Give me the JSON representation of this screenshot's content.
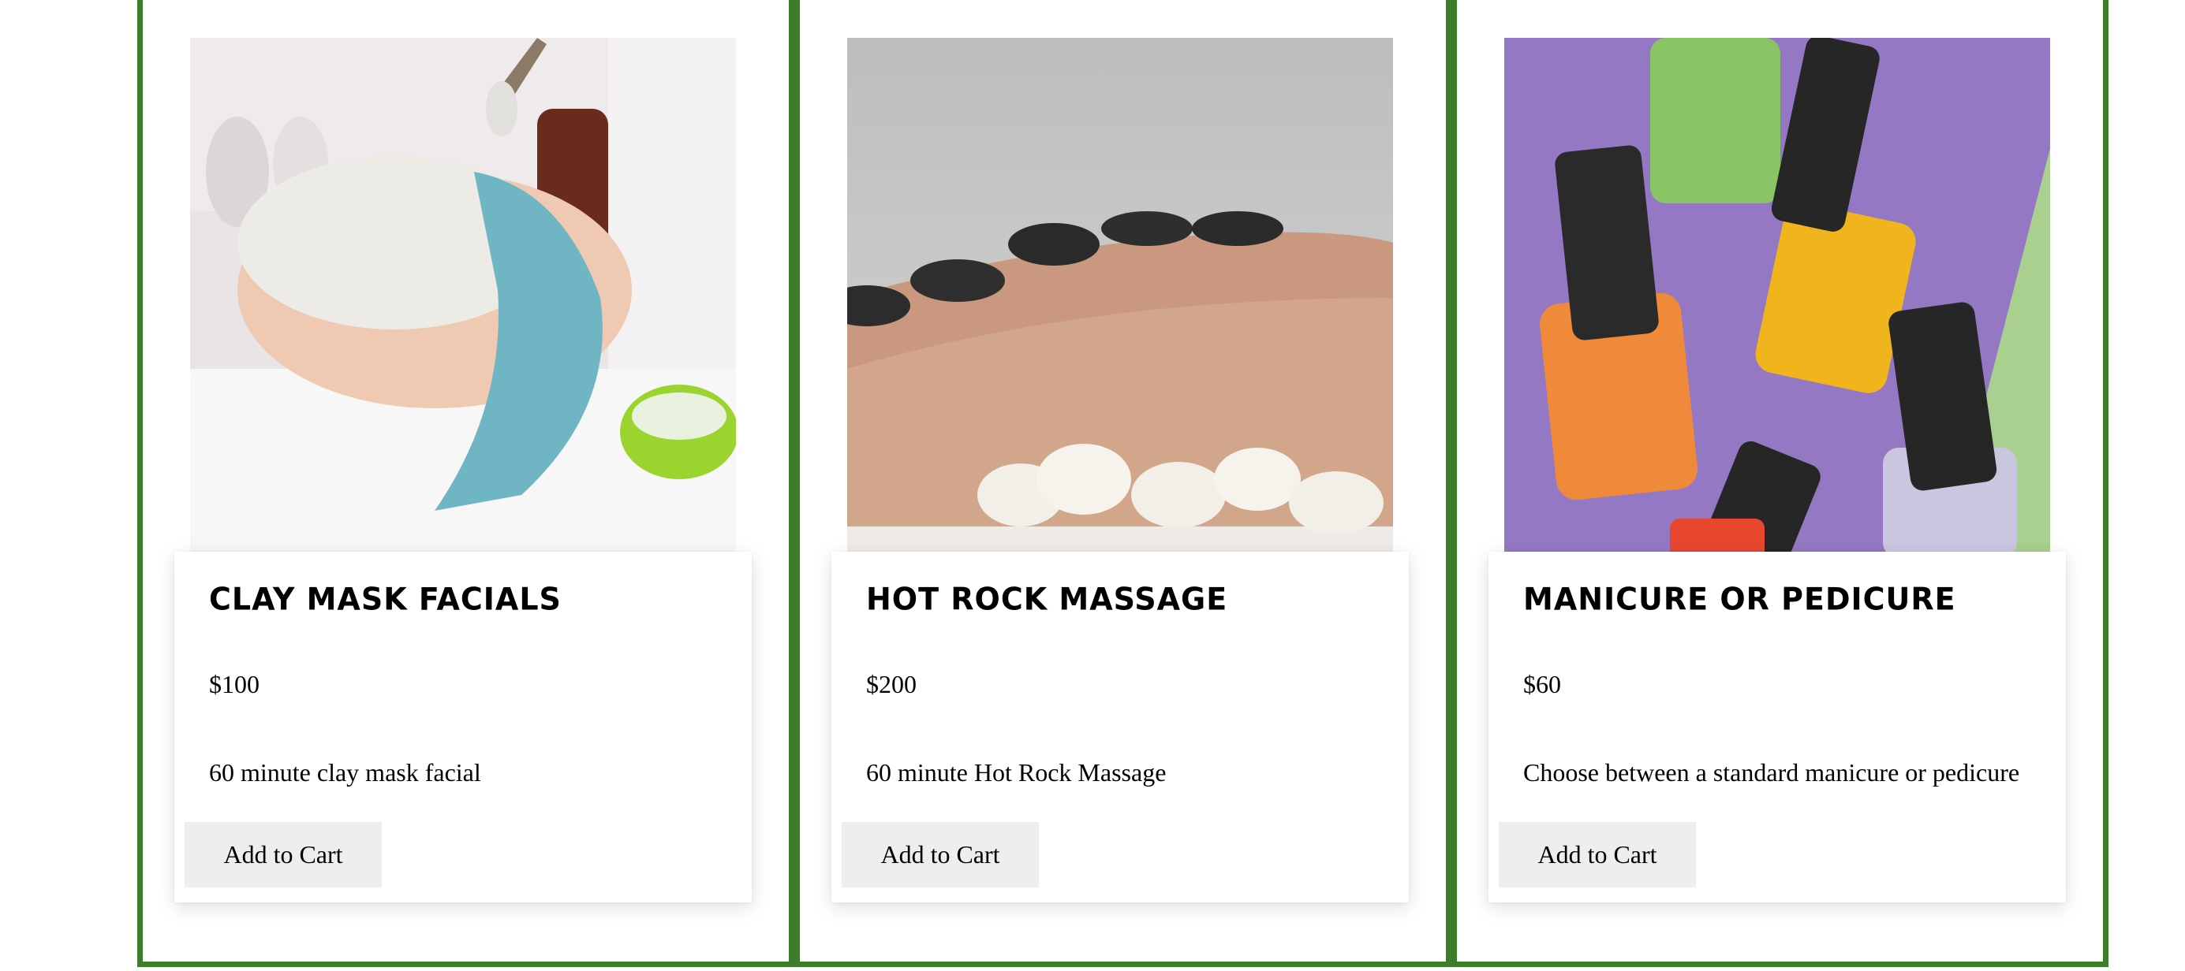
{
  "colors": {
    "border": "#3b7d29",
    "button_bg": "#eeeeee"
  },
  "services": [
    {
      "title": "Clay Mask Facials",
      "price": "$100",
      "description": "60 minute clay mask facial",
      "button": "Add to Cart",
      "image_alt": "clay-mask-facial-photo"
    },
    {
      "title": "Hot Rock Massage",
      "price": "$200",
      "description": "60 minute Hot Rock Massage",
      "button": "Add to Cart",
      "image_alt": "hot-rock-massage-photo"
    },
    {
      "title": "Manicure or Pedicure",
      "price": "$60",
      "description": "Choose between a standard manicure or pedicure",
      "button": "Add to Cart",
      "image_alt": "nail-lacquer-photo"
    }
  ]
}
